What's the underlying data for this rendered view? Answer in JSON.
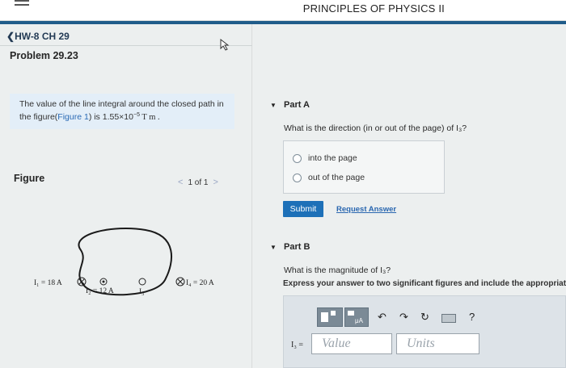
{
  "header": {
    "title": "PRINCIPLES OF PHYSICS II"
  },
  "nav": {
    "back_label": "HW-8 CH 29",
    "back_arrow": "❮"
  },
  "problem": {
    "title": "Problem 29.23",
    "statement_prefix": "The value of the line integral around the closed path in the figure(",
    "figure_link": "Figure 1",
    "statement_mid": ") is 1.55×10",
    "statement_exp": "−5",
    "statement_unit": " T m ."
  },
  "figure": {
    "label": "Figure",
    "pager": "1 of 1",
    "prev": "<",
    "next": ">",
    "currents": {
      "i1": "I₁ = 18 A",
      "i2": "I₂ = 12 A",
      "i3": "I₃",
      "i4": "I₄ = 20 A"
    }
  },
  "partA": {
    "title": "Part A",
    "question": "What is the direction (in or out of the page) of I₃?",
    "options": [
      "into the page",
      "out of the page"
    ],
    "submit": "Submit",
    "request": "Request Answer"
  },
  "partB": {
    "title": "Part B",
    "question": "What is the magnitude of I₃?",
    "instruction": "Express your answer to two significant figures and include the appropriate units.",
    "answer_label": "I₃ =",
    "value_placeholder": "Value",
    "units_placeholder": "Units"
  },
  "toolbar": {
    "icons": [
      "template-icon",
      "units-icon",
      "undo-icon",
      "redo-icon",
      "reset-icon",
      "keyboard-icon",
      "help-icon"
    ],
    "undo": "↶",
    "redo": "↷",
    "reset": "↻",
    "help": "?"
  },
  "colors": {
    "accent": "#1d70b8",
    "link": "#2a67b0",
    "header_strip": "#1f5c8a"
  }
}
